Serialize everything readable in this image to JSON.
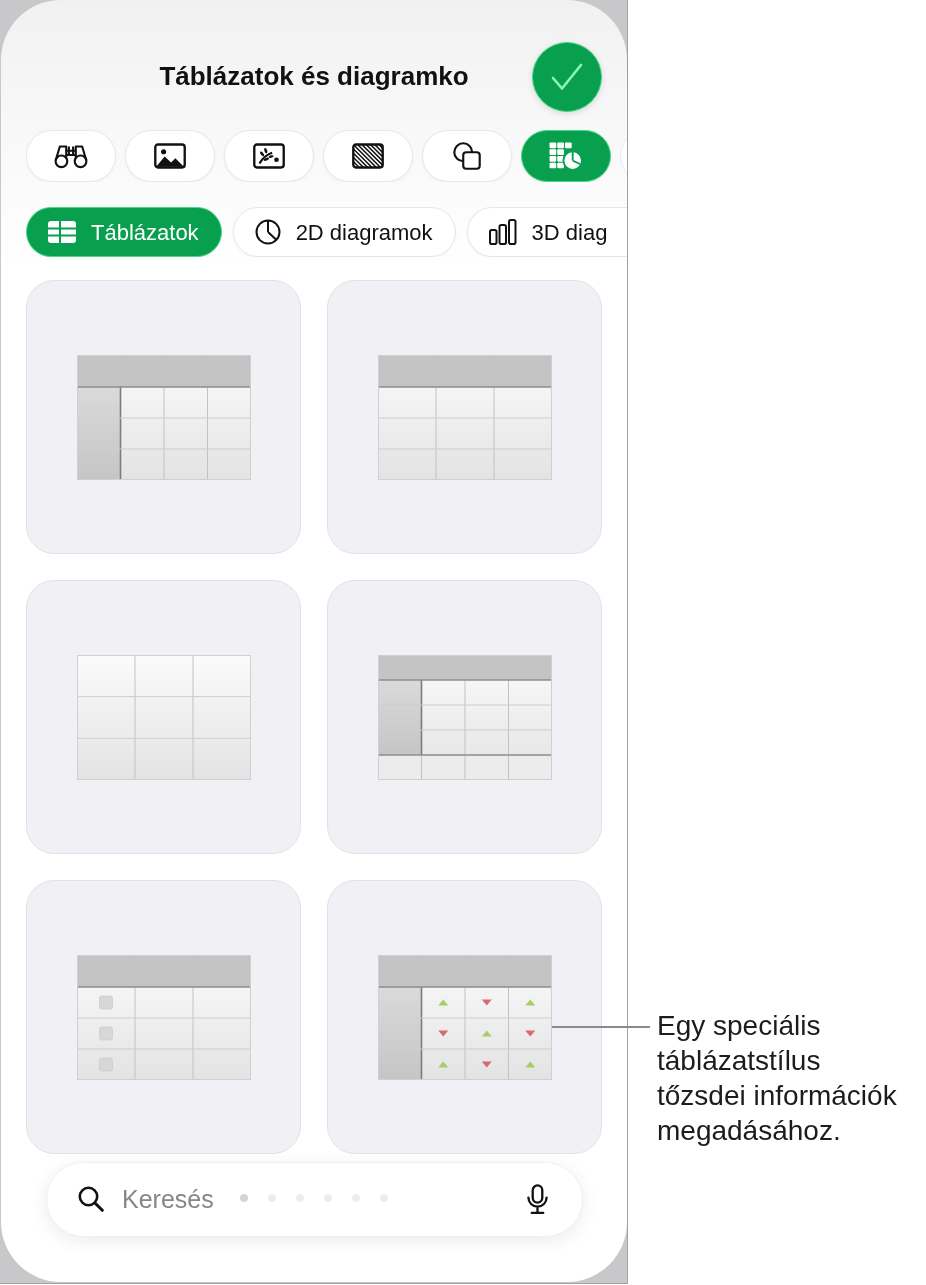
{
  "header": {
    "title": "Táblázatok és diagramko"
  },
  "insert_tabs": [
    {
      "kind": "binoculars",
      "selected": false
    },
    {
      "kind": "photo",
      "selected": false
    },
    {
      "kind": "artwork",
      "selected": false
    },
    {
      "kind": "pattern",
      "selected": false
    },
    {
      "kind": "shapes",
      "selected": false
    },
    {
      "kind": "tables",
      "selected": true
    },
    {
      "selected": false
    }
  ],
  "categories": [
    {
      "label": "Táblázatok",
      "kind": "table",
      "selected": true
    },
    {
      "label": "2D diagramok",
      "kind": "pie",
      "selected": false
    },
    {
      "label": "3D diag",
      "kind": "bars",
      "selected": false
    }
  ],
  "table_styles": [
    {
      "kind": "headers"
    },
    {
      "kind": "header"
    },
    {
      "kind": "plain"
    },
    {
      "kind": "footer"
    },
    {
      "kind": "checklist"
    },
    {
      "kind": "stock"
    }
  ],
  "search": {
    "placeholder": "Keresés"
  },
  "page_dots": [
    {
      "selected": true
    },
    {
      "selected": false
    },
    {
      "selected": false
    },
    {
      "selected": false
    },
    {
      "selected": false
    },
    {
      "selected": false
    }
  ],
  "callout": {
    "text": "Egy speciális táblázatstílus tőzsdei információk megadásához."
  }
}
